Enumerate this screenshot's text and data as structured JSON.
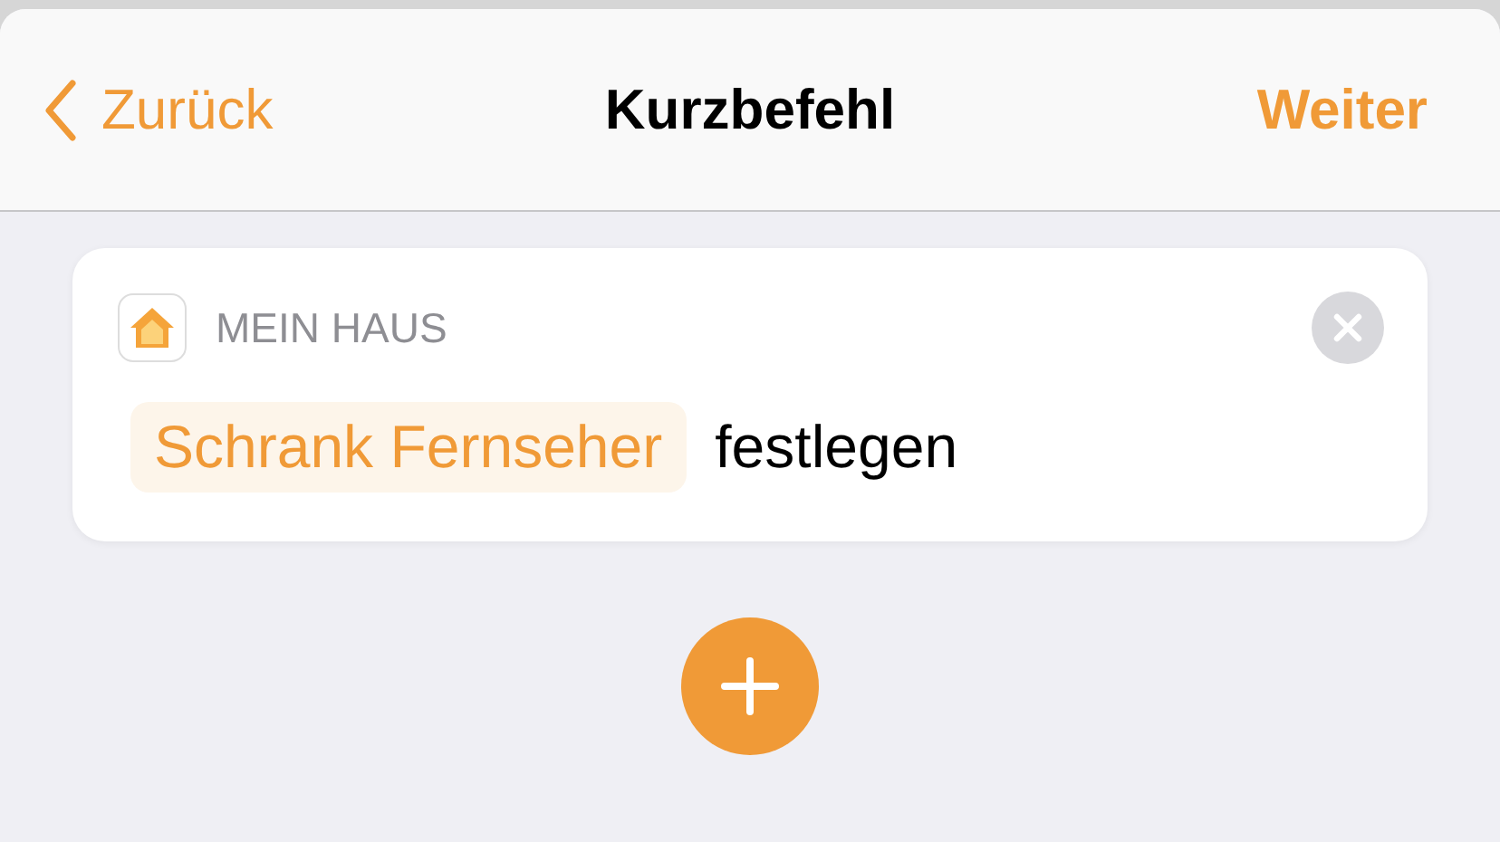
{
  "nav": {
    "back": "Zurück",
    "title": "Kurzbefehl",
    "next": "Weiter"
  },
  "action": {
    "app": "MEIN HAUS",
    "token": "Schrank Fernseher",
    "verb": "festlegen"
  }
}
